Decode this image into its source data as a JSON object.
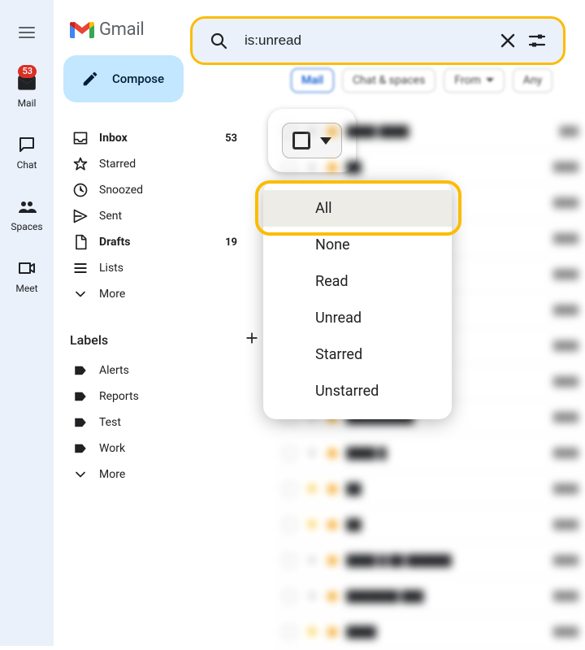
{
  "rail": {
    "mail_label": "Mail",
    "chat_label": "Chat",
    "spaces_label": "Spaces",
    "meet_label": "Meet",
    "mail_badge": "53"
  },
  "logo": {
    "text": "Gmail"
  },
  "compose": {
    "label": "Compose"
  },
  "nav": {
    "inbox": {
      "label": "Inbox",
      "count": "53"
    },
    "starred": {
      "label": "Starred"
    },
    "snoozed": {
      "label": "Snoozed"
    },
    "sent": {
      "label": "Sent"
    },
    "drafts": {
      "label": "Drafts",
      "count": "19"
    },
    "lists": {
      "label": "Lists"
    },
    "more": {
      "label": "More"
    }
  },
  "labels": {
    "header": "Labels",
    "items": [
      {
        "label": "Alerts"
      },
      {
        "label": "Reports"
      },
      {
        "label": "Test"
      },
      {
        "label": "Work"
      }
    ],
    "more": "More"
  },
  "search": {
    "query": "is:unread"
  },
  "chips": {
    "mail": "Mail",
    "chat_spaces": "Chat & spaces",
    "from": "From",
    "any": "Any"
  },
  "select_menu": {
    "items": [
      "All",
      "None",
      "Read",
      "Unread",
      "Starred",
      "Unstarred"
    ]
  }
}
